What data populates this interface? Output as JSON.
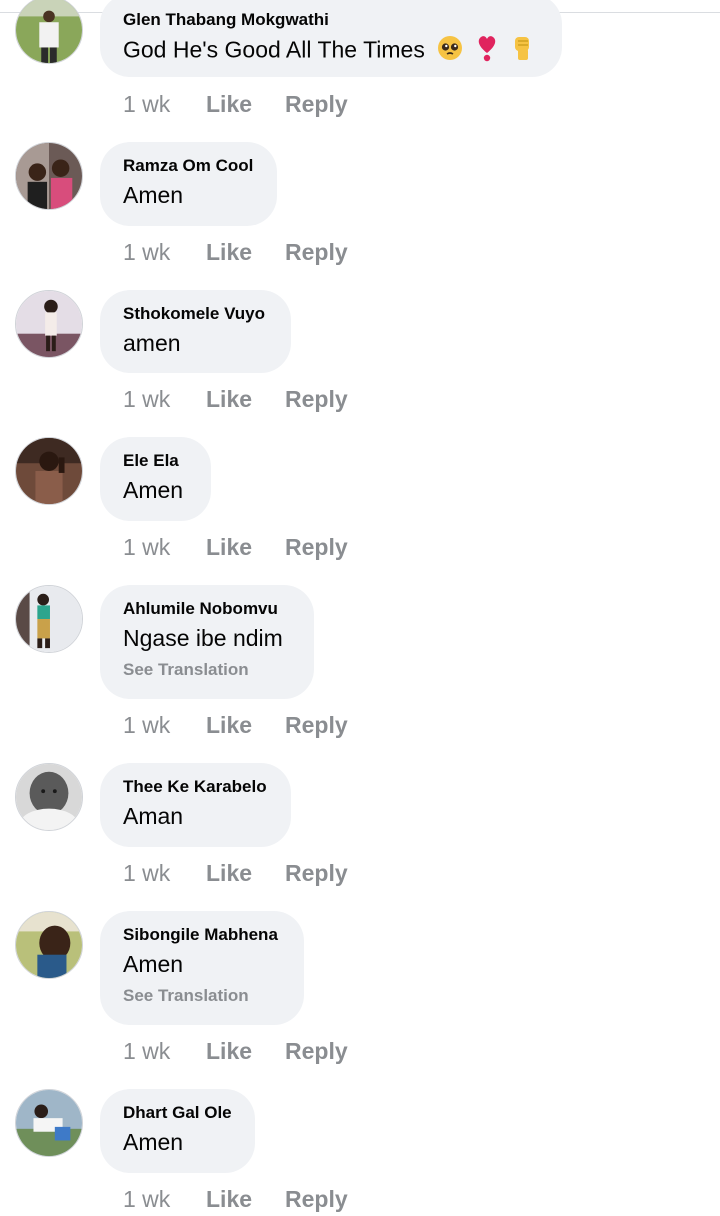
{
  "comments": [
    {
      "name": "Glen Thabang Mokgwathi",
      "text": "God He's Good All The Times",
      "time": "1 wk",
      "like": "Like",
      "reply": "Reply",
      "emojis": [
        "pleading-face-emoji",
        "heart-exclamation-emoji",
        "raised-fist-emoji"
      ]
    },
    {
      "name": "Ramza Om Cool",
      "text": "Amen",
      "time": "1 wk",
      "like": "Like",
      "reply": "Reply"
    },
    {
      "name": "Sthokomele Vuyo",
      "text": "amen",
      "time": "1 wk",
      "like": "Like",
      "reply": "Reply"
    },
    {
      "name": "Ele Ela",
      "text": "Amen",
      "time": "1 wk",
      "like": "Like",
      "reply": "Reply"
    },
    {
      "name": "Ahlumile Nobomvu",
      "text": "Ngase ibe ndim",
      "translation": "See Translation",
      "time": "1 wk",
      "like": "Like",
      "reply": "Reply"
    },
    {
      "name": "Thee Ke Karabelo",
      "text": "Aman",
      "time": "1 wk",
      "like": "Like",
      "reply": "Reply"
    },
    {
      "name": "Sibongile Mabhena",
      "text": "Amen",
      "translation": "See Translation",
      "time": "1 wk",
      "like": "Like",
      "reply": "Reply"
    },
    {
      "name": "Dhart Gal Ole",
      "text": "Amen",
      "time": "1 wk",
      "like": "Like",
      "reply": "Reply"
    }
  ],
  "colors": {
    "bubble_bg": "#f0f2f5",
    "secondary_text": "#8a8d91",
    "primary_text": "#050505"
  }
}
